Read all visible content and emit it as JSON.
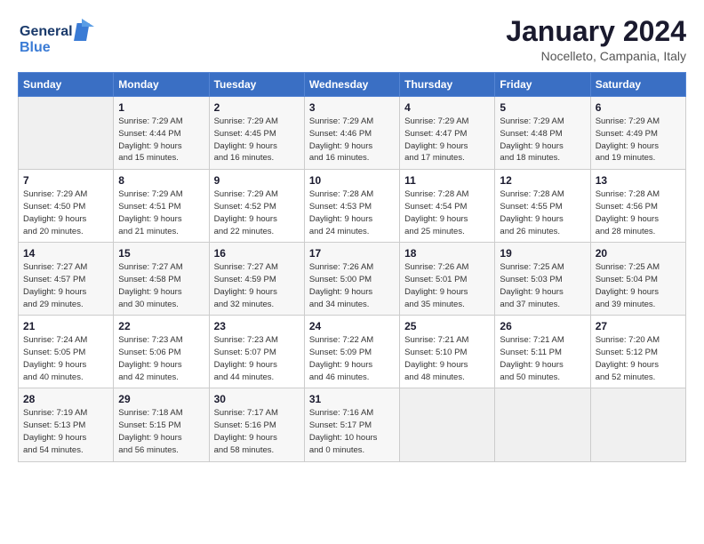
{
  "header": {
    "title": "January 2024",
    "location": "Nocelleto, Campania, Italy"
  },
  "columns": [
    "Sunday",
    "Monday",
    "Tuesday",
    "Wednesday",
    "Thursday",
    "Friday",
    "Saturday"
  ],
  "weeks": [
    [
      {
        "day": "",
        "info": ""
      },
      {
        "day": "1",
        "info": "Sunrise: 7:29 AM\nSunset: 4:44 PM\nDaylight: 9 hours\nand 15 minutes."
      },
      {
        "day": "2",
        "info": "Sunrise: 7:29 AM\nSunset: 4:45 PM\nDaylight: 9 hours\nand 16 minutes."
      },
      {
        "day": "3",
        "info": "Sunrise: 7:29 AM\nSunset: 4:46 PM\nDaylight: 9 hours\nand 16 minutes."
      },
      {
        "day": "4",
        "info": "Sunrise: 7:29 AM\nSunset: 4:47 PM\nDaylight: 9 hours\nand 17 minutes."
      },
      {
        "day": "5",
        "info": "Sunrise: 7:29 AM\nSunset: 4:48 PM\nDaylight: 9 hours\nand 18 minutes."
      },
      {
        "day": "6",
        "info": "Sunrise: 7:29 AM\nSunset: 4:49 PM\nDaylight: 9 hours\nand 19 minutes."
      }
    ],
    [
      {
        "day": "7",
        "info": "Sunrise: 7:29 AM\nSunset: 4:50 PM\nDaylight: 9 hours\nand 20 minutes."
      },
      {
        "day": "8",
        "info": "Sunrise: 7:29 AM\nSunset: 4:51 PM\nDaylight: 9 hours\nand 21 minutes."
      },
      {
        "day": "9",
        "info": "Sunrise: 7:29 AM\nSunset: 4:52 PM\nDaylight: 9 hours\nand 22 minutes."
      },
      {
        "day": "10",
        "info": "Sunrise: 7:28 AM\nSunset: 4:53 PM\nDaylight: 9 hours\nand 24 minutes."
      },
      {
        "day": "11",
        "info": "Sunrise: 7:28 AM\nSunset: 4:54 PM\nDaylight: 9 hours\nand 25 minutes."
      },
      {
        "day": "12",
        "info": "Sunrise: 7:28 AM\nSunset: 4:55 PM\nDaylight: 9 hours\nand 26 minutes."
      },
      {
        "day": "13",
        "info": "Sunrise: 7:28 AM\nSunset: 4:56 PM\nDaylight: 9 hours\nand 28 minutes."
      }
    ],
    [
      {
        "day": "14",
        "info": "Sunrise: 7:27 AM\nSunset: 4:57 PM\nDaylight: 9 hours\nand 29 minutes."
      },
      {
        "day": "15",
        "info": "Sunrise: 7:27 AM\nSunset: 4:58 PM\nDaylight: 9 hours\nand 30 minutes."
      },
      {
        "day": "16",
        "info": "Sunrise: 7:27 AM\nSunset: 4:59 PM\nDaylight: 9 hours\nand 32 minutes."
      },
      {
        "day": "17",
        "info": "Sunrise: 7:26 AM\nSunset: 5:00 PM\nDaylight: 9 hours\nand 34 minutes."
      },
      {
        "day": "18",
        "info": "Sunrise: 7:26 AM\nSunset: 5:01 PM\nDaylight: 9 hours\nand 35 minutes."
      },
      {
        "day": "19",
        "info": "Sunrise: 7:25 AM\nSunset: 5:03 PM\nDaylight: 9 hours\nand 37 minutes."
      },
      {
        "day": "20",
        "info": "Sunrise: 7:25 AM\nSunset: 5:04 PM\nDaylight: 9 hours\nand 39 minutes."
      }
    ],
    [
      {
        "day": "21",
        "info": "Sunrise: 7:24 AM\nSunset: 5:05 PM\nDaylight: 9 hours\nand 40 minutes."
      },
      {
        "day": "22",
        "info": "Sunrise: 7:23 AM\nSunset: 5:06 PM\nDaylight: 9 hours\nand 42 minutes."
      },
      {
        "day": "23",
        "info": "Sunrise: 7:23 AM\nSunset: 5:07 PM\nDaylight: 9 hours\nand 44 minutes."
      },
      {
        "day": "24",
        "info": "Sunrise: 7:22 AM\nSunset: 5:09 PM\nDaylight: 9 hours\nand 46 minutes."
      },
      {
        "day": "25",
        "info": "Sunrise: 7:21 AM\nSunset: 5:10 PM\nDaylight: 9 hours\nand 48 minutes."
      },
      {
        "day": "26",
        "info": "Sunrise: 7:21 AM\nSunset: 5:11 PM\nDaylight: 9 hours\nand 50 minutes."
      },
      {
        "day": "27",
        "info": "Sunrise: 7:20 AM\nSunset: 5:12 PM\nDaylight: 9 hours\nand 52 minutes."
      }
    ],
    [
      {
        "day": "28",
        "info": "Sunrise: 7:19 AM\nSunset: 5:13 PM\nDaylight: 9 hours\nand 54 minutes."
      },
      {
        "day": "29",
        "info": "Sunrise: 7:18 AM\nSunset: 5:15 PM\nDaylight: 9 hours\nand 56 minutes."
      },
      {
        "day": "30",
        "info": "Sunrise: 7:17 AM\nSunset: 5:16 PM\nDaylight: 9 hours\nand 58 minutes."
      },
      {
        "day": "31",
        "info": "Sunrise: 7:16 AM\nSunset: 5:17 PM\nDaylight: 10 hours\nand 0 minutes."
      },
      {
        "day": "",
        "info": ""
      },
      {
        "day": "",
        "info": ""
      },
      {
        "day": "",
        "info": ""
      }
    ]
  ]
}
